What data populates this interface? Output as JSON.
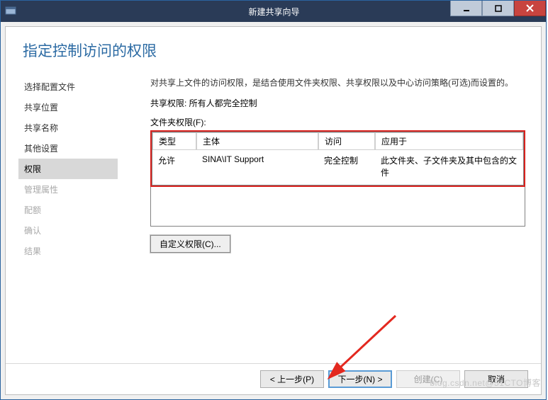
{
  "window": {
    "title": "新建共享向导"
  },
  "page_title": "指定控制访问的权限",
  "sidebar": {
    "items": [
      {
        "label": "选择配置文件",
        "state": "past"
      },
      {
        "label": "共享位置",
        "state": "past"
      },
      {
        "label": "共享名称",
        "state": "past"
      },
      {
        "label": "其他设置",
        "state": "past"
      },
      {
        "label": "权限",
        "state": "active"
      },
      {
        "label": "管理属性",
        "state": "future"
      },
      {
        "label": "配额",
        "state": "future"
      },
      {
        "label": "确认",
        "state": "future"
      },
      {
        "label": "结果",
        "state": "future"
      }
    ]
  },
  "main": {
    "description": "对共享上文件的访问权限，是结合使用文件夹权限、共享权限以及中心访问策略(可选)而设置的。",
    "share_perm_label": "共享权限: 所有人都完全控制",
    "folder_perm_label": "文件夹权限(F):",
    "columns": {
      "type": "类型",
      "subject": "主体",
      "access": "访问",
      "apply": "应用于"
    },
    "rows": [
      {
        "type": "允许",
        "subject": "SINA\\IT Support",
        "access": "完全控制",
        "apply": "此文件夹、子文件夹及其中包含的文件"
      }
    ],
    "custom_btn": "自定义权限(C)..."
  },
  "buttons": {
    "prev": "< 上一步(P)",
    "next": "下一步(N) >",
    "create": "创建(C)",
    "cancel": "取消"
  },
  "watermark": "blog.csdn.net@51CTO博客"
}
